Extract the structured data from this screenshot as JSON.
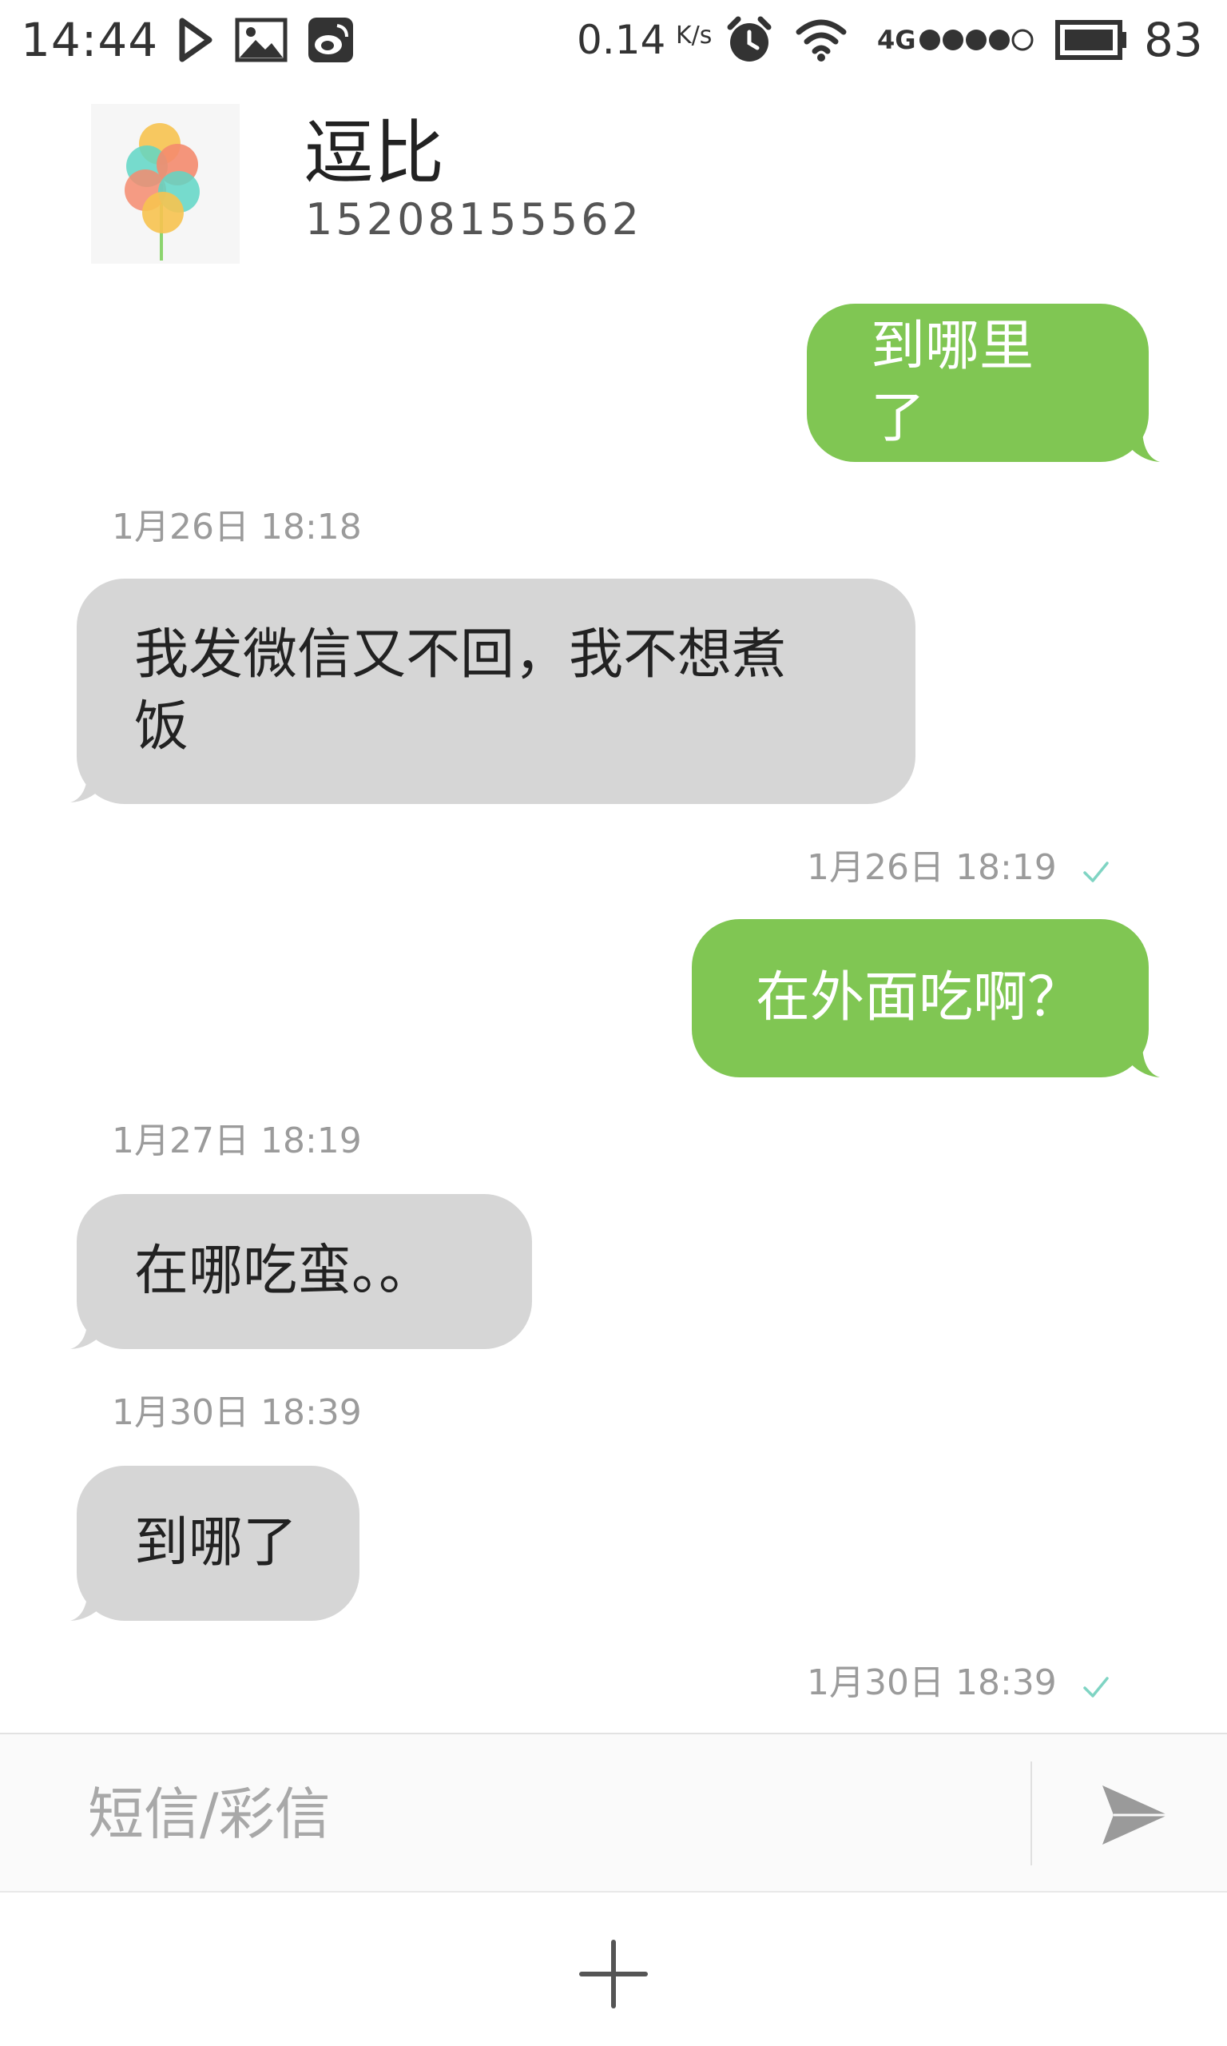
{
  "status_bar": {
    "time": "14:44",
    "net_speed": "0.14",
    "net_speed_unit": "K/s",
    "network_type": "4G",
    "battery_level": "83",
    "signal_bars": 4,
    "icons": [
      "play-icon",
      "image-icon",
      "weibo-icon",
      "alarm-icon",
      "wifi-icon",
      "signal-icon",
      "battery-icon"
    ]
  },
  "contact": {
    "name": "逗比",
    "phone": "15208155562"
  },
  "messages": [
    {
      "direction": "outgoing",
      "text": "到哪里了"
    },
    {
      "timestamp": "1月26日 18:18",
      "direction": "incoming",
      "lines": [
        "我发微信又不回，我不想煮",
        "饭"
      ]
    },
    {
      "timestamp": "1月26日 18:19",
      "direction": "outgoing",
      "text": "在外面吃啊？",
      "read": true
    },
    {
      "timestamp": "1月27日 18:19",
      "direction": "incoming",
      "text": "在哪吃蛮。。"
    },
    {
      "timestamp": "1月30日 18:39",
      "direction": "incoming",
      "text": "到哪了"
    },
    {
      "timestamp": "1月30日 18:39",
      "read": true
    }
  ],
  "compose": {
    "placeholder": "短信/彩信",
    "value": ""
  },
  "colors": {
    "outgoing_bubble": "#80c653",
    "incoming_bubble": "#d6d6d6",
    "read_check": "#7fd4c3",
    "timestamp_text": "#9b9b9b"
  }
}
